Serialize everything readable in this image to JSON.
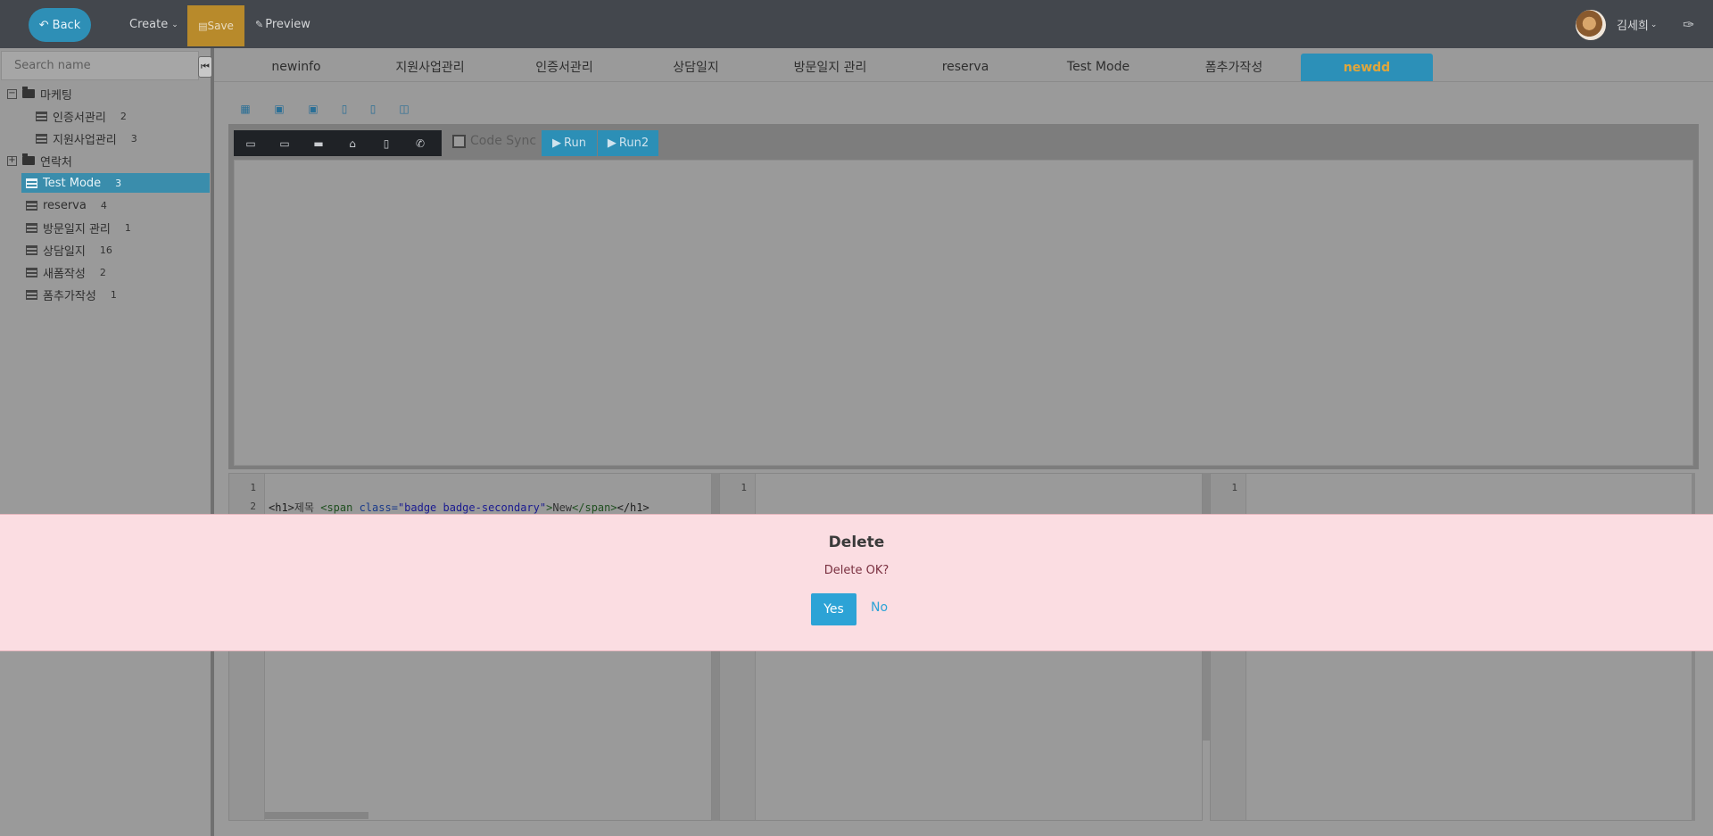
{
  "topbar": {
    "back_label": "Back",
    "create_label": "Create",
    "save_label": "Save",
    "preview_label": "Preview",
    "user_name": "김세희",
    "colors": {
      "bar": "#43474d",
      "back": "#2e8fb6",
      "save": "#b88a2b"
    }
  },
  "sidebar": {
    "search_placeholder": "Search name",
    "tree": [
      {
        "label": "마케팅",
        "type": "folder",
        "expanded": true,
        "toggle": "−"
      },
      {
        "label": "인증서관리",
        "count": "2",
        "type": "table",
        "child": true
      },
      {
        "label": "지원사업관리",
        "count": "3",
        "type": "table",
        "child": true
      },
      {
        "label": "연락처",
        "type": "folder",
        "expanded": false,
        "toggle": "+"
      },
      {
        "label": "Test Mode",
        "count": "3",
        "type": "table",
        "selected": true
      },
      {
        "label": "reserva",
        "count": "4",
        "type": "table"
      },
      {
        "label": "방문일지 관리",
        "count": "1",
        "type": "table"
      },
      {
        "label": "상담일지",
        "count": "16",
        "type": "table"
      },
      {
        "label": "새폼작성",
        "count": "2",
        "type": "table"
      },
      {
        "label": "폼추가작성",
        "count": "1",
        "type": "table"
      }
    ]
  },
  "tabs": [
    {
      "label": "newinfo"
    },
    {
      "label": "지원사업관리"
    },
    {
      "label": "인증서관리"
    },
    {
      "label": "상담일지"
    },
    {
      "label": "방문일지 관리"
    },
    {
      "label": "reserva"
    },
    {
      "label": "Test Mode"
    },
    {
      "label": "폼추가작성"
    },
    {
      "label": "newdd",
      "active": true
    }
  ],
  "preview": {
    "code_sync_label": "Code Sync",
    "run_label": "Run",
    "run2_label": "Run2",
    "device_icons": [
      "browser-icon",
      "monitor-icon",
      "desktop-icon",
      "laptop-icon",
      "tablet-icon",
      "phone-icon"
    ],
    "layout_icons": [
      "grid-layout-icon",
      "layout-top-icon",
      "layout-bottom-icon",
      "layout-left-icon",
      "layout-right-icon",
      "layout-split-icon"
    ]
  },
  "editors": {
    "html": {
      "line_numbers": [
        "1",
        "2"
      ],
      "line2": {
        "open_h1": "<h1>",
        "title_text": "제목 ",
        "span_open": "<span ",
        "class_attr": "class=",
        "class_value": "\"badge badge-secondary\"",
        "span_close_bracket": ">",
        "inner": "New",
        "span_end": "</span>",
        "h1_end": "</h1>"
      }
    },
    "css": {
      "line_numbers": [
        "1"
      ]
    },
    "js": {
      "line_numbers": [
        "1"
      ]
    }
  },
  "dialog": {
    "title": "Delete",
    "message": "Delete OK?",
    "yes_label": "Yes",
    "no_label": "No",
    "colors": {
      "background": "#fbdde2",
      "yes": "#2ca3d6"
    }
  }
}
